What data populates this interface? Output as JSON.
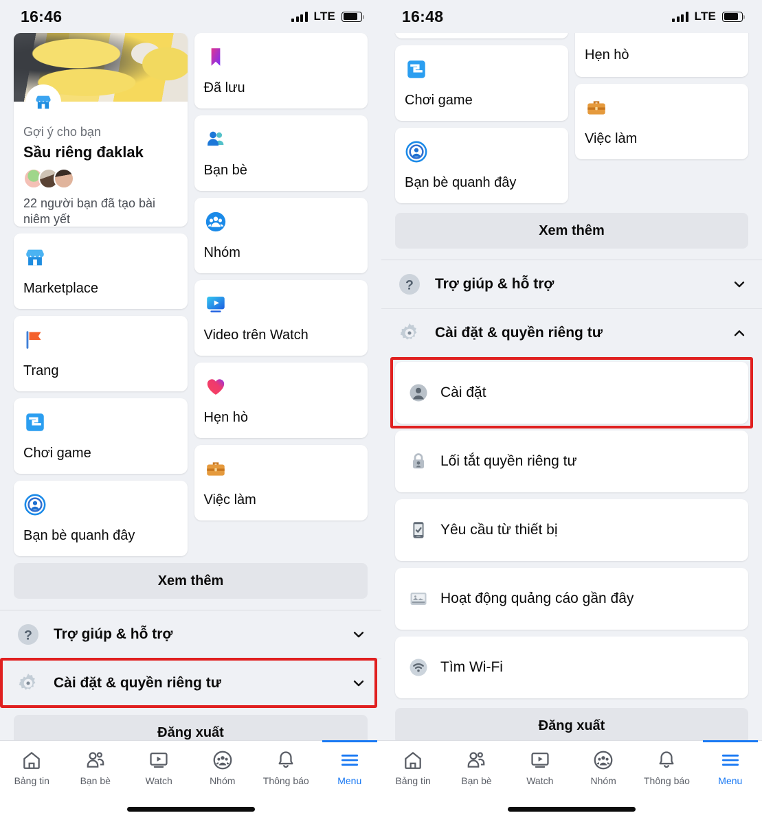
{
  "left_phone": {
    "status_bar": {
      "time": "16:46",
      "network": "LTE",
      "signal_icon": "signal-bars-icon",
      "battery_icon": "battery-icon"
    },
    "suggestion_card": {
      "icon": "marketplace-storefront-icon",
      "kicker": "Gợi ý cho bạn",
      "title": "Sầu riêng đaklak",
      "subtitle": "22 người bạn đã tạo bài niêm yết",
      "image": "durian-photo"
    },
    "left_column_cards": [
      {
        "label": "Marketplace",
        "icon": "marketplace-storefront-icon"
      },
      {
        "label": "Trang",
        "icon": "pages-flag-icon"
      },
      {
        "label": "Chơi game",
        "icon": "gaming-controller-icon"
      },
      {
        "label": "Bạn bè quanh đây",
        "icon": "nearby-friends-icon"
      }
    ],
    "right_column_cards": [
      {
        "label": "Đã lưu",
        "icon": "saved-bookmark-icon"
      },
      {
        "label": "Bạn bè",
        "icon": "friends-icon"
      },
      {
        "label": "Nhóm",
        "icon": "groups-icon"
      },
      {
        "label": "Video trên Watch",
        "icon": "watch-video-icon"
      },
      {
        "label": "Hẹn hò",
        "icon": "dating-heart-icon"
      },
      {
        "label": "Việc làm",
        "icon": "jobs-briefcase-icon"
      }
    ],
    "see_more_label": "Xem thêm",
    "expandable_rows": [
      {
        "label": "Trợ giúp & hỗ trợ",
        "icon": "help-question-icon",
        "chevron": "chevron-down-icon",
        "expanded": false,
        "highlighted": false
      },
      {
        "label": "Cài đặt & quyền riêng tư",
        "icon": "settings-gear-icon",
        "chevron": "chevron-down-icon",
        "expanded": false,
        "highlighted": true
      }
    ],
    "logout_label": "Đăng xuất"
  },
  "right_phone": {
    "status_bar": {
      "time": "16:48",
      "network": "LTE",
      "signal_icon": "signal-bars-icon",
      "battery_icon": "battery-icon"
    },
    "left_column_cards": [
      {
        "label": "Chơi game",
        "icon": "gaming-controller-icon"
      },
      {
        "label": "Bạn bè quanh đây",
        "icon": "nearby-friends-icon"
      }
    ],
    "right_column_cards": [
      {
        "label": "Hẹn hò",
        "icon": "dating-heart-icon"
      },
      {
        "label": "Việc làm",
        "icon": "jobs-briefcase-icon"
      }
    ],
    "see_more_label": "Xem thêm",
    "expandable_rows": [
      {
        "label": "Trợ giúp & hỗ trợ",
        "icon": "help-question-icon",
        "chevron": "chevron-down-icon",
        "expanded": false,
        "highlighted": false
      },
      {
        "label": "Cài đặt & quyền riêng tư",
        "icon": "settings-gear-icon",
        "chevron": "chevron-up-icon",
        "expanded": true,
        "highlighted": false
      }
    ],
    "settings_items": [
      {
        "label": "Cài đặt",
        "icon": "profile-avatar-icon",
        "highlighted": true
      },
      {
        "label": "Lối tắt quyền riêng tư",
        "icon": "privacy-lock-icon",
        "highlighted": false
      },
      {
        "label": "Yêu cầu từ thiết bị",
        "icon": "device-request-icon",
        "highlighted": false
      },
      {
        "label": "Hoạt động quảng cáo gần đây",
        "icon": "ad-activity-icon",
        "highlighted": false
      },
      {
        "label": "Tìm Wi-Fi",
        "icon": "wifi-icon",
        "highlighted": false
      }
    ],
    "logout_label": "Đăng xuất"
  },
  "tab_bar": {
    "items": [
      {
        "label": "Bảng tin",
        "icon": "home-icon",
        "active": false
      },
      {
        "label": "Bạn bè",
        "icon": "friends-icon",
        "active": false
      },
      {
        "label": "Watch",
        "icon": "watch-icon",
        "active": false
      },
      {
        "label": "Nhóm",
        "icon": "groups-icon",
        "active": false
      },
      {
        "label": "Thông báo",
        "icon": "bell-icon",
        "active": false
      },
      {
        "label": "Menu",
        "icon": "hamburger-menu-icon",
        "active": true
      }
    ]
  },
  "colors": {
    "accent": "#1878f3",
    "highlight_red": "#e02020",
    "page_bg": "#eff1f5",
    "card_bg": "#ffffff",
    "grey_button": "#e3e5ea"
  }
}
